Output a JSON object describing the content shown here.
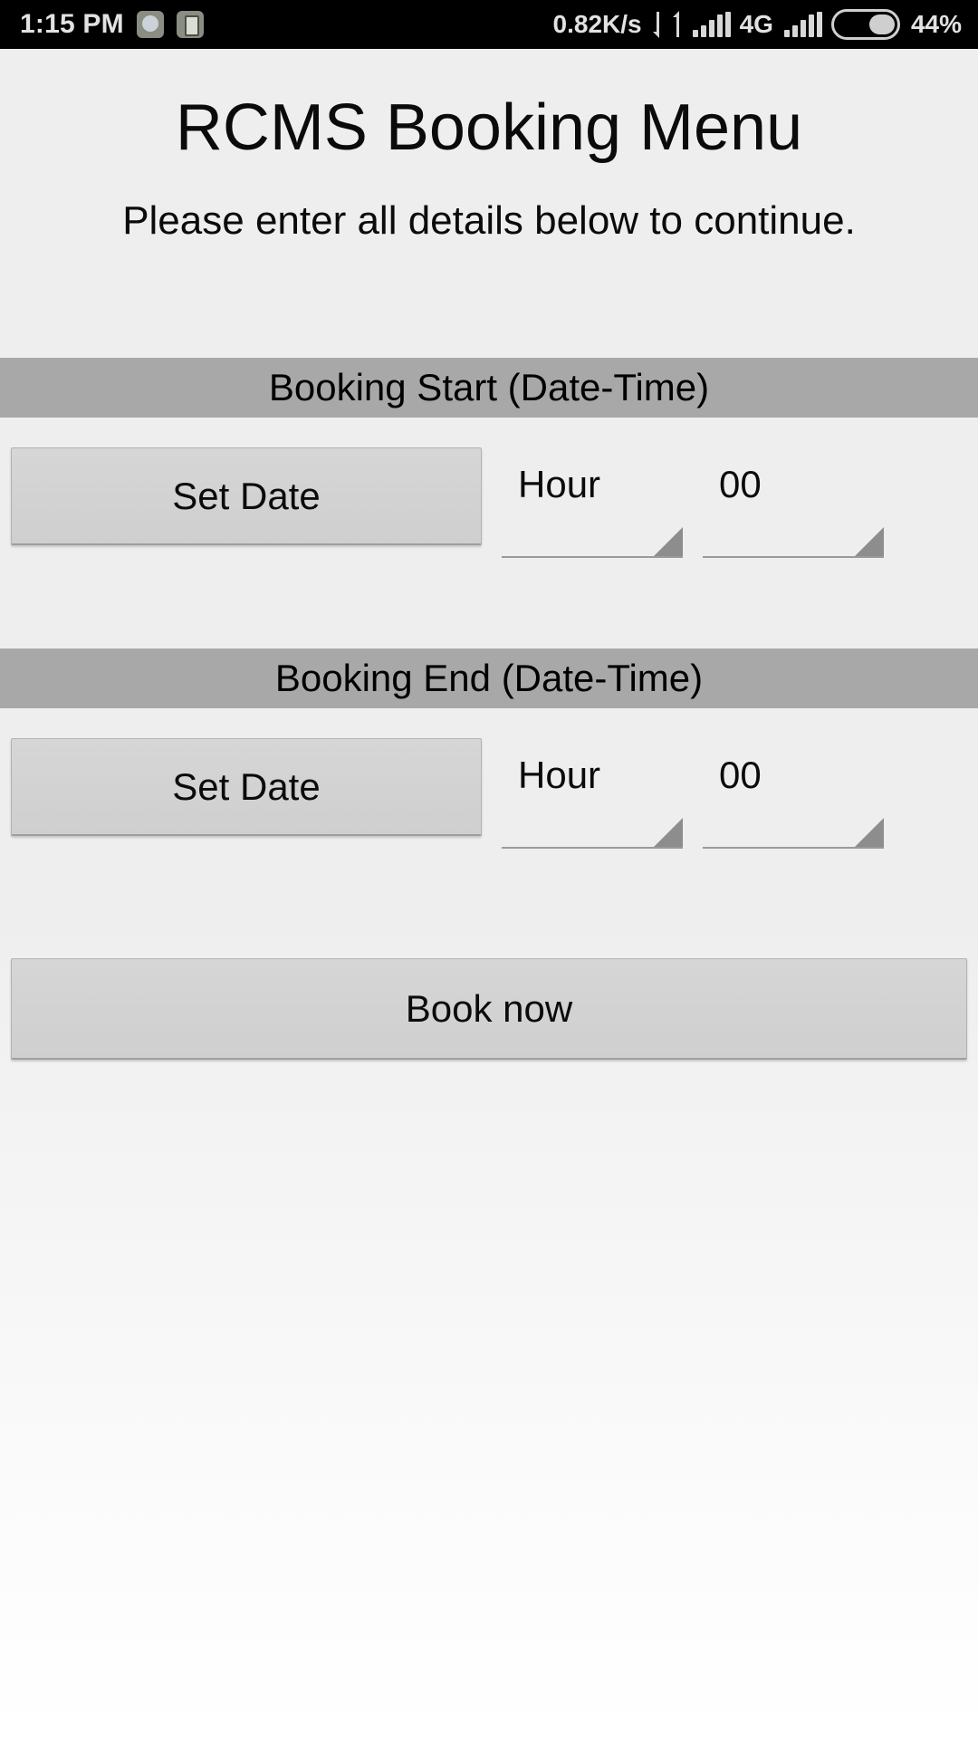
{
  "status_bar": {
    "clock": "1:15 PM",
    "notification_icons": [
      "globe-app-icon",
      "document-app-icon"
    ],
    "network_speed": "0.82K/s",
    "data_arrows_icon": "data-transfer-arrows-icon",
    "signal_icon_1": "signal-bars-icon",
    "network_type": "4G",
    "signal_icon_2": "signal-bars-icon",
    "battery_icon": "battery-icon",
    "battery_level_percent": 44,
    "battery_percent_label": "44%",
    "background_color": "#000000",
    "foreground_color": "#e2e2e2"
  },
  "header": {
    "title": "RCMS Booking Menu",
    "subtitle": "Please enter all details below to continue."
  },
  "sections": [
    {
      "band_label": "Booking Start (Date-Time)",
      "set_date_button": "Set Date",
      "hour_spinner_value": "Hour",
      "minute_spinner_value": "00"
    },
    {
      "band_label": "Booking End (Date-Time)",
      "set_date_button": "Set Date",
      "hour_spinner_value": "Hour",
      "minute_spinner_value": "00"
    }
  ],
  "submit": {
    "label": "Book now"
  },
  "colors": {
    "page_background": "#eeeeee",
    "band_background": "#a8a8a8",
    "button_background": "#d2d2d2",
    "button_border": "#b3b3b3",
    "spinner_underline": "#9a9a9a",
    "spinner_arrow": "#8d8d8d",
    "text": "#0b0b0b"
  }
}
